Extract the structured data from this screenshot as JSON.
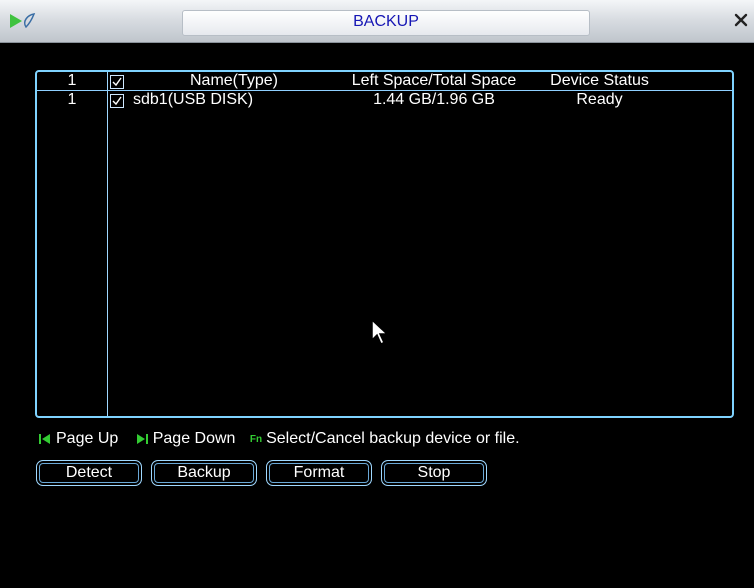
{
  "window": {
    "title": "BACKUP"
  },
  "table": {
    "header": {
      "index": "1",
      "name": "Name(Type)",
      "space": "Left Space/Total Space",
      "status": "Device Status"
    },
    "rows": [
      {
        "index": "1",
        "checked": true,
        "name": "sdb1(USB DISK)",
        "space": "1.44 GB/1.96 GB",
        "status": "Ready"
      }
    ]
  },
  "legend": {
    "page_up": "Page Up",
    "page_down": "Page Down",
    "fn_badge": "Fn",
    "fn_text": "Select/Cancel backup device or file."
  },
  "buttons": {
    "detect": "Detect",
    "backup": "Backup",
    "format": "Format",
    "stop": "Stop"
  },
  "colors": {
    "title_text": "#1616b4",
    "frame_border": "#7fd3ff",
    "legend_icon": "#33cc33"
  }
}
